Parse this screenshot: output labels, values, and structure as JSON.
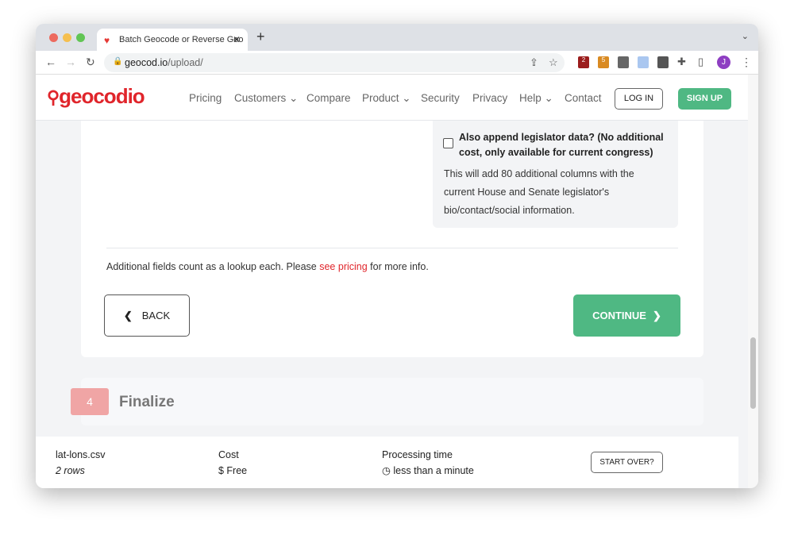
{
  "browser": {
    "tab_title": "Batch Geocode or Reverse Geo",
    "url_host": "geocod.io",
    "url_path": "/upload/",
    "ext_badges": [
      "2",
      "5"
    ],
    "avatar": "J"
  },
  "header": {
    "logo": "geocodio",
    "menu": [
      "Pricing",
      "Customers",
      "Compare",
      "Product",
      "Security",
      "Privacy",
      "Help",
      "Contact"
    ],
    "login": "LOG IN",
    "signup": "SIGN UP"
  },
  "options": {
    "legislator_label": "Also append legislator data? (No additional cost, only available for current congress)",
    "legislator_checked": false,
    "legislator_desc": "This will add 80 additional columns with the current House and Senate legislator's bio/contact/social information."
  },
  "note": {
    "before": "Additional fields count as a lookup each. Please ",
    "link": "see pricing",
    "after": " for more info."
  },
  "buttons": {
    "back": "BACK",
    "continue": "CONTINUE"
  },
  "step": {
    "number": "4",
    "title": "Finalize"
  },
  "footer": {
    "filename": "lat-lons.csv",
    "rows": "2 rows",
    "cost_label": "Cost",
    "cost_value": "$ Free",
    "time_label": "Processing time",
    "time_value": "less than a minute",
    "start_over": "START OVER?"
  },
  "colors": {
    "brand": "#e0252b",
    "green": "#4fb883",
    "step_badge": "#f0a5a5"
  }
}
